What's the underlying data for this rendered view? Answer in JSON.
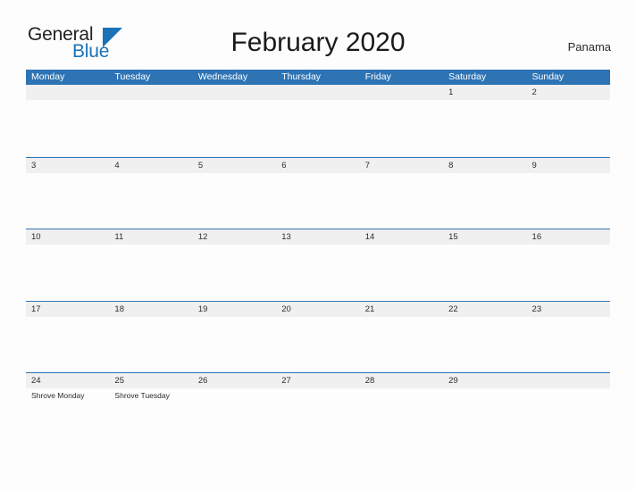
{
  "header": {
    "logo_part1": "General",
    "logo_part2": "Blue",
    "logo_triangle_color": "#1b72b8",
    "title": "February 2020",
    "country": "Panama"
  },
  "theme": {
    "header_blue": "#2e74b5",
    "band_gray": "#f0f0f0",
    "page_bg": "#fdfdfd",
    "text_dark": "#2b2b2b"
  },
  "calendar": {
    "month": "February",
    "year": "2020",
    "weekday_headers": [
      "Monday",
      "Tuesday",
      "Wednesday",
      "Thursday",
      "Friday",
      "Saturday",
      "Sunday"
    ],
    "weeks": [
      {
        "days": [
          {
            "date": "",
            "events": []
          },
          {
            "date": "",
            "events": []
          },
          {
            "date": "",
            "events": []
          },
          {
            "date": "",
            "events": []
          },
          {
            "date": "",
            "events": []
          },
          {
            "date": "1",
            "events": []
          },
          {
            "date": "2",
            "events": []
          }
        ]
      },
      {
        "days": [
          {
            "date": "3",
            "events": []
          },
          {
            "date": "4",
            "events": []
          },
          {
            "date": "5",
            "events": []
          },
          {
            "date": "6",
            "events": []
          },
          {
            "date": "7",
            "events": []
          },
          {
            "date": "8",
            "events": []
          },
          {
            "date": "9",
            "events": []
          }
        ]
      },
      {
        "days": [
          {
            "date": "10",
            "events": []
          },
          {
            "date": "11",
            "events": []
          },
          {
            "date": "12",
            "events": []
          },
          {
            "date": "13",
            "events": []
          },
          {
            "date": "14",
            "events": []
          },
          {
            "date": "15",
            "events": []
          },
          {
            "date": "16",
            "events": []
          }
        ]
      },
      {
        "days": [
          {
            "date": "17",
            "events": []
          },
          {
            "date": "18",
            "events": []
          },
          {
            "date": "19",
            "events": []
          },
          {
            "date": "20",
            "events": []
          },
          {
            "date": "21",
            "events": []
          },
          {
            "date": "22",
            "events": []
          },
          {
            "date": "23",
            "events": []
          }
        ]
      },
      {
        "days": [
          {
            "date": "24",
            "events": [
              "Shrove Monday"
            ]
          },
          {
            "date": "25",
            "events": [
              "Shrove Tuesday"
            ]
          },
          {
            "date": "26",
            "events": []
          },
          {
            "date": "27",
            "events": []
          },
          {
            "date": "28",
            "events": []
          },
          {
            "date": "29",
            "events": []
          },
          {
            "date": "",
            "events": []
          }
        ]
      }
    ]
  }
}
